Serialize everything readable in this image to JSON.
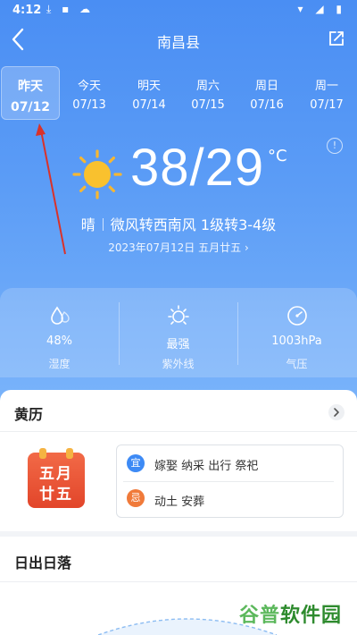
{
  "status_bar": {
    "time": "4:12"
  },
  "header": {
    "city": "南昌县"
  },
  "days": [
    {
      "name": "昨天",
      "date": "07/12",
      "selected": true
    },
    {
      "name": "今天",
      "date": "07/13"
    },
    {
      "name": "明天",
      "date": "07/14"
    },
    {
      "name": "周六",
      "date": "07/15"
    },
    {
      "name": "周日",
      "date": "07/16"
    },
    {
      "name": "周一",
      "date": "07/17"
    }
  ],
  "weather": {
    "temp": "38/29",
    "unit": "°C",
    "condition": "晴",
    "wind": "微风转西南风 1级转3-4级",
    "date_line": "2023年07月12日 五月廿五",
    "date_chevron": "›"
  },
  "stats": [
    {
      "value": "48%",
      "label": "湿度",
      "icon": "humidity-icon"
    },
    {
      "value": "最强",
      "label": "紫外线",
      "icon": "sun-uv-icon"
    },
    {
      "value": "1003hPa",
      "label": "气压",
      "icon": "pressure-gauge-icon"
    }
  ],
  "almanac": {
    "title": "黄历",
    "calendar_line1": "五月",
    "calendar_line2": "廿五",
    "yi_badge": "宜",
    "yi_text": "嫁娶 纳采 出行 祭祀",
    "ji_badge": "忌",
    "ji_text": "动土 安葬"
  },
  "sunrise": {
    "title": "日出日落"
  },
  "watermark": {
    "part1": "谷普",
    "part2": "软件园"
  },
  "colors": {
    "accent_blue": "#4a8ef3",
    "yi_blue": "#3d8af5",
    "ji_orange": "#f07a3a",
    "calendar_red": "#e2452a"
  }
}
